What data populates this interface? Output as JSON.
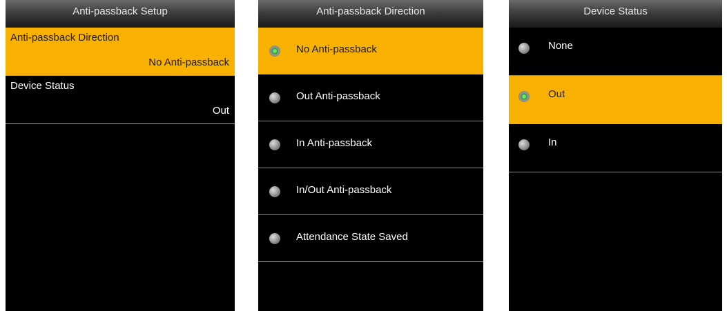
{
  "screen1": {
    "title": "Anti-passback Setup",
    "items": [
      {
        "name": "Anti-passback Direction",
        "value": "No Anti-passback",
        "selected": true
      },
      {
        "name": "Device Status",
        "value": "Out",
        "selected": false
      }
    ]
  },
  "screen2": {
    "title": "Anti-passback Direction",
    "options": [
      {
        "label": "No Anti-passback",
        "checked": true
      },
      {
        "label": "Out Anti-passback",
        "checked": false
      },
      {
        "label": "In Anti-passback",
        "checked": false
      },
      {
        "label": "In/Out Anti-passback",
        "checked": false
      },
      {
        "label": "Attendance State Saved",
        "checked": false
      }
    ]
  },
  "screen3": {
    "title": "Device Status",
    "options": [
      {
        "label": "None",
        "checked": false
      },
      {
        "label": "Out",
        "checked": true
      },
      {
        "label": "In",
        "checked": false
      }
    ]
  },
  "colors": {
    "highlight": "#f9b100",
    "background": "#000000",
    "radio_on": "#3cc43c"
  },
  "icons": {
    "radio_on": "radio-selected-icon",
    "radio_off": "radio-unselected-icon"
  }
}
